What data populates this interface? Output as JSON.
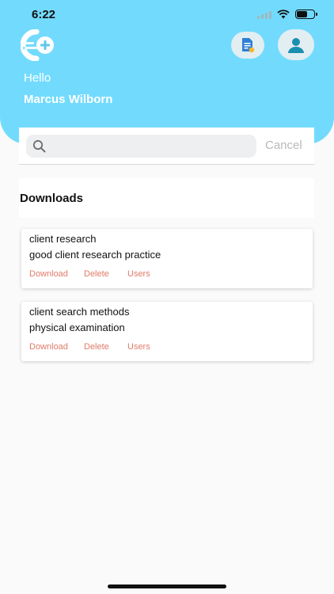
{
  "status_bar": {
    "time": "6:22",
    "battery_percent": 60
  },
  "header": {
    "logo_icon": "cloud-plus-logo-icon",
    "doc_icon": "document-icon",
    "profile_icon": "user-icon",
    "greeting": "Hello",
    "user_name": "Marcus Wilborn"
  },
  "search": {
    "value": "",
    "placeholder": "",
    "cancel_label": "Cancel"
  },
  "section": {
    "title": "Downloads"
  },
  "downloads": [
    {
      "title": "client research",
      "subtitle": "good client research practice",
      "actions": {
        "download": "Download",
        "delete": "Delete",
        "users": "Users"
      }
    },
    {
      "title": "client search methods",
      "subtitle": "physical examination",
      "actions": {
        "download": "Download",
        "delete": "Delete",
        "users": "Users"
      }
    }
  ],
  "colors": {
    "header_bg": "#72dbfd",
    "action_text": "#e07b68",
    "cancel_text": "#b9b9b9",
    "icon_teal": "#1c8fb0"
  }
}
